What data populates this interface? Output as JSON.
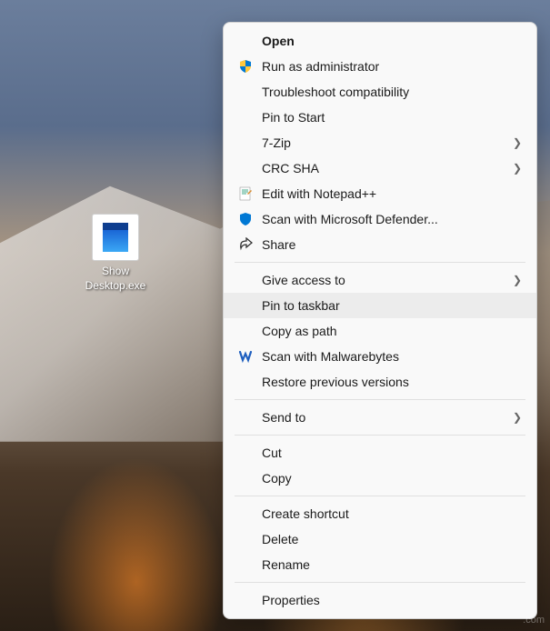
{
  "desktop": {
    "icon_label": "Show Desktop.exe"
  },
  "menu": {
    "open": "Open",
    "run_admin": "Run as administrator",
    "troubleshoot": "Troubleshoot compatibility",
    "pin_start": "Pin to Start",
    "seven_zip": "7-Zip",
    "crc_sha": "CRC SHA",
    "edit_notepad": "Edit with Notepad++",
    "scan_defender": "Scan with Microsoft Defender...",
    "share": "Share",
    "give_access": "Give access to",
    "pin_taskbar": "Pin to taskbar",
    "copy_path": "Copy as path",
    "scan_malwarebytes": "Scan with Malwarebytes",
    "restore_versions": "Restore previous versions",
    "send_to": "Send to",
    "cut": "Cut",
    "copy": "Copy",
    "create_shortcut": "Create shortcut",
    "delete": "Delete",
    "rename": "Rename",
    "properties": "Properties"
  },
  "watermark": ".com"
}
